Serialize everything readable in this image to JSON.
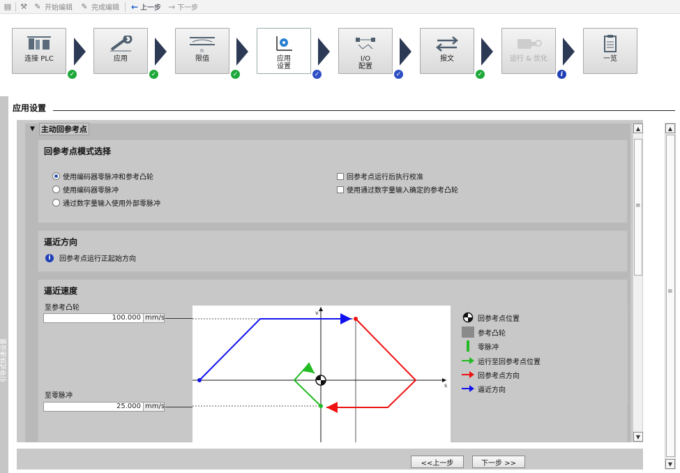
{
  "toolbar": {
    "start_edit": "开始编辑",
    "finish_edit": "完成编辑",
    "prev": "上一步",
    "next": "下一步"
  },
  "steps": [
    {
      "label": "连接 PLC",
      "status": "ok"
    },
    {
      "label": "应用",
      "status": "ok"
    },
    {
      "label": "限值",
      "status": "ok"
    },
    {
      "label": "应用\n设置",
      "status": "blue"
    },
    {
      "label": "I/O\n配置",
      "status": "blue"
    },
    {
      "label": "报文",
      "status": "ok"
    },
    {
      "label": "运行 & 优化",
      "status": "info"
    },
    {
      "label": "一览",
      "status": "none"
    }
  ],
  "sidebar_vertical_text": "引导式快速设置",
  "section_title": "应用设置",
  "group_title": "主动回参考点",
  "mode_card": {
    "title": "回参考点模式选择",
    "radios": [
      {
        "label": "使用编码器零脉冲和参考凸轮",
        "selected": true
      },
      {
        "label": "使用编码器零脉冲",
        "selected": false
      },
      {
        "label": "通过数字量输入使用外部零脉冲",
        "selected": false
      }
    ],
    "checks": [
      {
        "label": "回参考点运行后执行校准",
        "checked": false
      },
      {
        "label": "使用通过数字量输入确定的参考凸轮",
        "checked": false
      }
    ]
  },
  "approach_dir_card": {
    "title": "逼近方向",
    "info_icon_text": "i",
    "info": "回参考点运行正起始方向"
  },
  "speed_card": {
    "title": "逼近速度",
    "to_cam_label": "至参考凸轮",
    "to_cam_value": "100.000",
    "to_cam_unit": "mm/s",
    "to_zero_label": "至零脉冲",
    "to_zero_value": "25.000",
    "to_zero_unit": "mm/s"
  },
  "diagram": {
    "axis_v": "v",
    "axis_s": "s"
  },
  "legend": [
    {
      "icon": "reference-point-icon",
      "label": "回参考点位置"
    },
    {
      "icon": "reference-cam-icon",
      "label": "参考凸轮",
      "color": "#8a8a8a"
    },
    {
      "icon": "zero-pulse-icon",
      "label": "零脉冲",
      "color": "#22bb22"
    },
    {
      "icon": "green-arrow-icon",
      "label": "运行至回参考点位置",
      "color": "#22bb22"
    },
    {
      "icon": "red-arrow-icon",
      "label": "回参考点方向",
      "color": "#ee1111"
    },
    {
      "icon": "blue-arrow-icon",
      "label": "逼近方向",
      "color": "#1111ee"
    }
  ],
  "buttons": {
    "prev": "<<上一步",
    "next": "下一步 >>"
  }
}
